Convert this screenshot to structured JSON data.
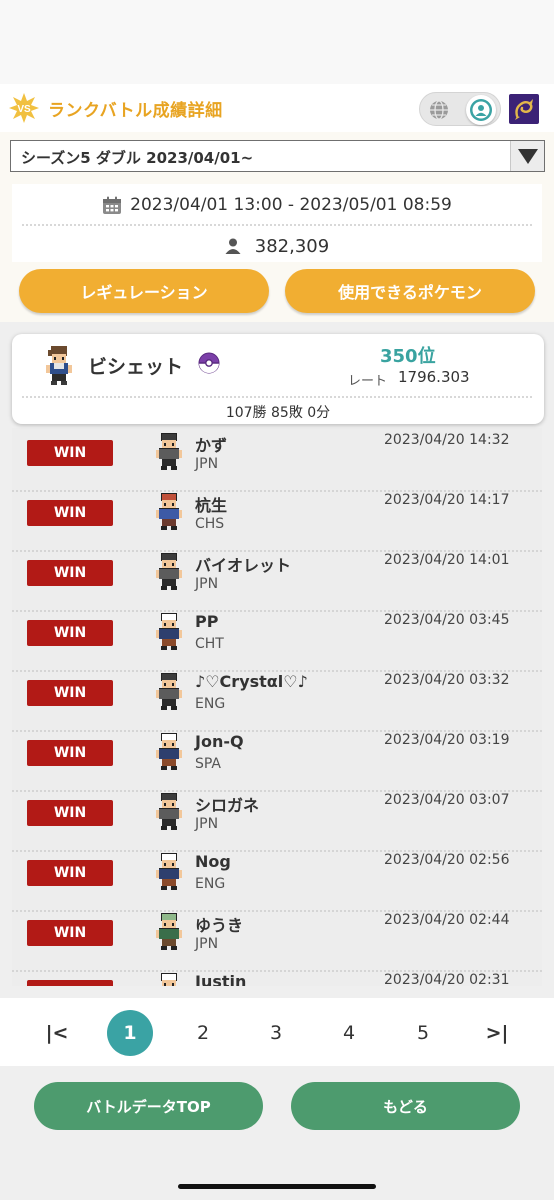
{
  "header": {
    "badge_label": "VS",
    "title": "ランクバトル成績詳細",
    "globe_icon": "globe-icon",
    "person_icon": "person-icon",
    "game_icon": "dragon-game-icon"
  },
  "season": {
    "selected": "シーズン5 ダブル 2023/04/01~"
  },
  "period": {
    "range": "2023/04/01 13:00 - 2023/05/01 08:59",
    "players": "382,309"
  },
  "buttons": {
    "regulation": "レギュレーション",
    "usable_pokemon": "使用できるポケモン"
  },
  "player": {
    "name": "ビシェット",
    "rank": "350位",
    "rate_label": "レート",
    "rate_value": "1796.303",
    "record": "107勝 85敗 0分"
  },
  "matches": [
    {
      "result": "WIN",
      "name": "かず",
      "lang": "JPN",
      "time": "2023/04/20 14:32",
      "sprite": "gray"
    },
    {
      "result": "WIN",
      "name": "杭生",
      "lang": "CHS",
      "time": "2023/04/20 14:17",
      "sprite": "red"
    },
    {
      "result": "WIN",
      "name": "バイオレット",
      "lang": "JPN",
      "time": "2023/04/20 14:01",
      "sprite": "gray"
    },
    {
      "result": "WIN",
      "name": "PP",
      "lang": "CHT",
      "time": "2023/04/20 03:45",
      "sprite": "brown"
    },
    {
      "result": "WIN",
      "name": "♪♡Crystαl♡♪",
      "lang": "ENG",
      "time": "2023/04/20 03:32",
      "sprite": "gray"
    },
    {
      "result": "WIN",
      "name": "Jon-Q",
      "lang": "SPA",
      "time": "2023/04/20 03:19",
      "sprite": "brown"
    },
    {
      "result": "WIN",
      "name": "シロガネ",
      "lang": "JPN",
      "time": "2023/04/20 03:07",
      "sprite": "gray"
    },
    {
      "result": "WIN",
      "name": "Nog",
      "lang": "ENG",
      "time": "2023/04/20 02:56",
      "sprite": "brown"
    },
    {
      "result": "WIN",
      "name": "ゆうき",
      "lang": "JPN",
      "time": "2023/04/20 02:44",
      "sprite": "green"
    },
    {
      "result": "WIN",
      "name": "Justin",
      "lang": "",
      "time": "2023/04/20 02:31",
      "sprite": "brown"
    }
  ],
  "pagination": {
    "first": "|<",
    "pages": [
      "1",
      "2",
      "3",
      "4",
      "5"
    ],
    "last": ">|",
    "current": "1"
  },
  "footer": {
    "battle_data_top": "バトルデータTOP",
    "back": "もどる"
  },
  "colors": {
    "orange": "#f1ae32",
    "teal": "#3aa3a4",
    "win_red": "#b21a16",
    "green": "#4d9b6e",
    "title_orange": "#e8a422"
  }
}
